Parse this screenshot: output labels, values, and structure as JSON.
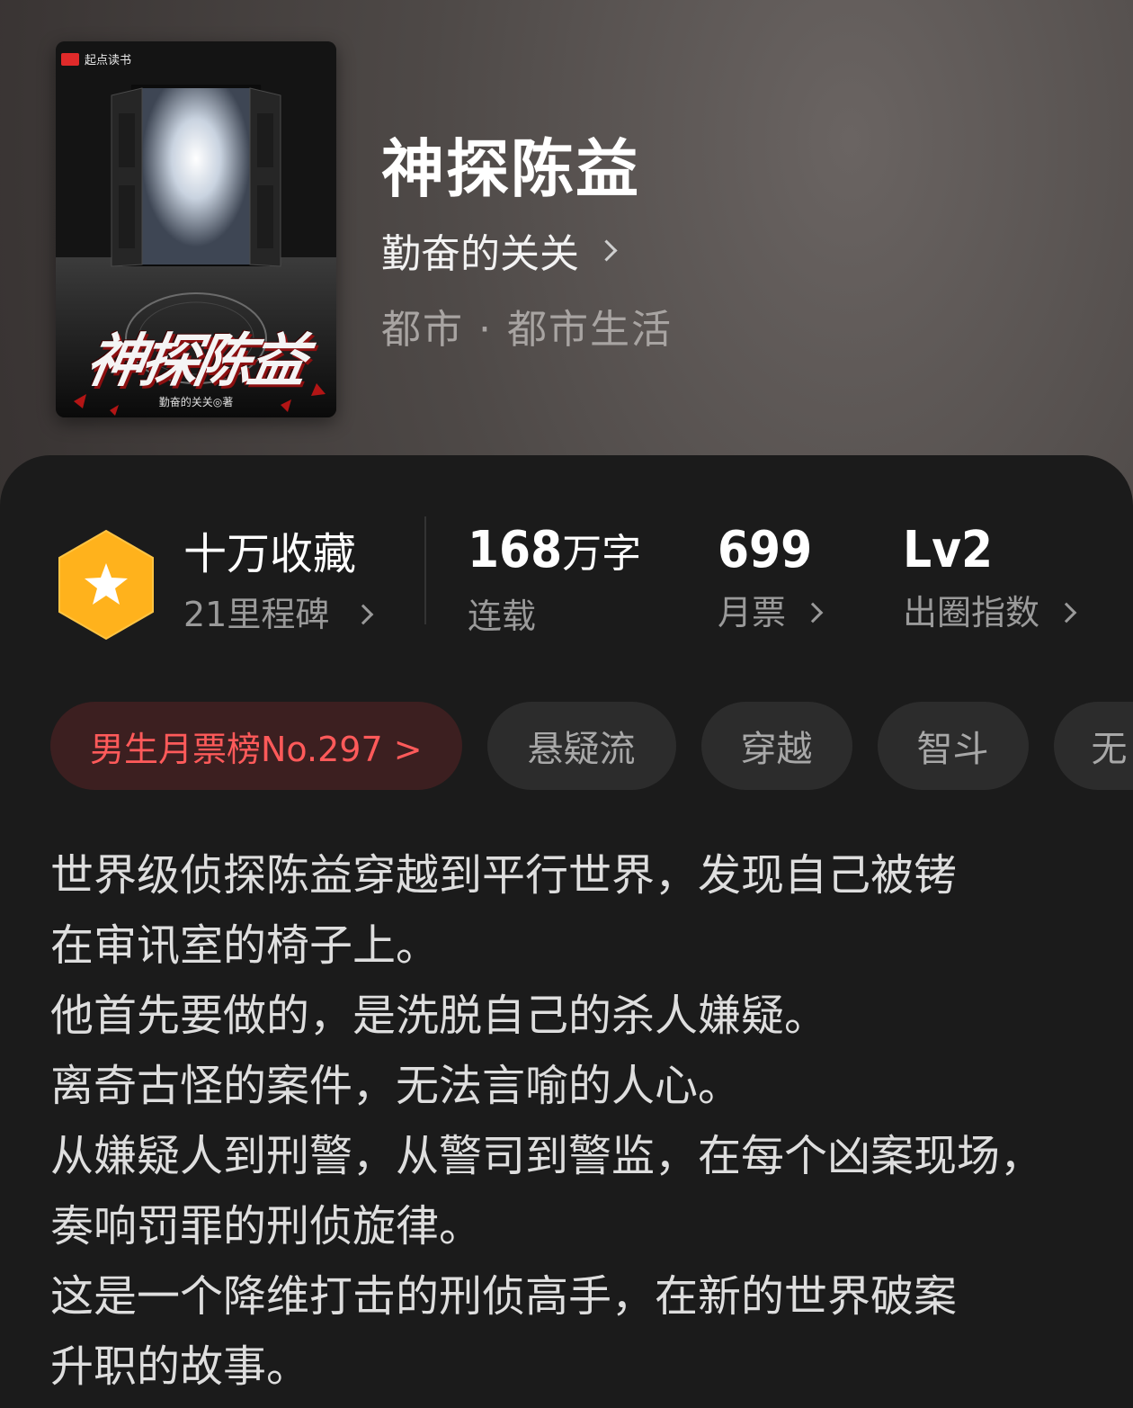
{
  "cover": {
    "brand": "起点读书",
    "title_art": "神探陈益",
    "author_art": "勤奋的关关◎著"
  },
  "book": {
    "title": "神探陈益",
    "author": "勤奋的关关",
    "category": "都市 · 都市生活"
  },
  "stats": {
    "collect": {
      "main": "十万收藏",
      "sub": "21里程碑"
    },
    "words": {
      "number": "168",
      "unit": "万字",
      "label": "连载"
    },
    "votes": {
      "number": "699",
      "label": "月票"
    },
    "level": {
      "number": "Lv2",
      "label": "出圈指数"
    }
  },
  "tags": [
    "男生月票榜No.297 >",
    "悬疑流",
    "穿越",
    "智斗",
    "无"
  ],
  "description": [
    "世界级侦探陈益穿越到平行世界，发现自己被铐",
    "在审讯室的椅子上。",
    "他首先要做的，是洗脱自己的杀人嫌疑。",
    "离奇古怪的案件，无法言喻的人心。",
    "从嫌疑人到刑警，从警司到警监，在每个凶案现场，",
    "奏响罚罪的刑侦旋律。",
    "这是一个降维打击的刑侦高手，在新的世界破案",
    "升职的故事。"
  ],
  "colors": {
    "badge": "#ffb21c",
    "rank_text": "#ff5a5a",
    "rank_bg": "#3c1f20",
    "panel_bg": "#1b1b1b"
  }
}
